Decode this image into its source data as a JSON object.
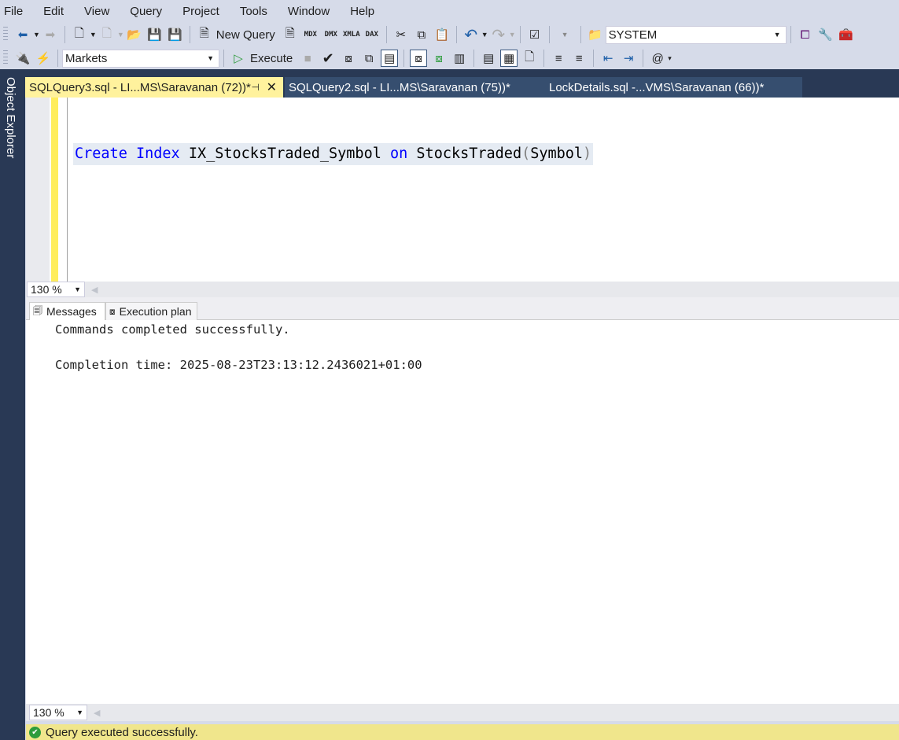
{
  "menu": [
    "File",
    "Edit",
    "View",
    "Query",
    "Project",
    "Tools",
    "Window",
    "Help"
  ],
  "toolbar": {
    "new_query": "New Query",
    "mdx": "MDX",
    "dmx": "DMX",
    "xmla": "XMLA",
    "dax": "DAX",
    "server": "SYSTEM",
    "database": "Markets",
    "execute": "Execute"
  },
  "sidebar": {
    "object_explorer": "Object Explorer"
  },
  "tabs": [
    {
      "label": "SQLQuery3.sql - LI...MS\\Saravanan (72))*",
      "active": true
    },
    {
      "label": "SQLQuery2.sql - LI...MS\\Saravanan (75))*"
    },
    {
      "label": "LockDetails.sql -...VMS\\Saravanan (66))*"
    }
  ],
  "editor": {
    "kw1": "Create",
    "kw2": "Index",
    "name": "IX_StocksTraded_Symbol",
    "kw3": "on",
    "table": "StocksTraded",
    "lp": "(",
    "col": "Symbol",
    "rp": ")",
    "zoom": "130 %"
  },
  "results": {
    "tabs": [
      "Messages",
      "Execution plan"
    ],
    "line1": "Commands completed successfully.",
    "line2": "Completion time: 2025-08-23T23:13:12.2436021+01:00",
    "zoom": "130 %"
  },
  "status": {
    "text": "Query executed successfully.",
    "color": "#f0e68c"
  }
}
